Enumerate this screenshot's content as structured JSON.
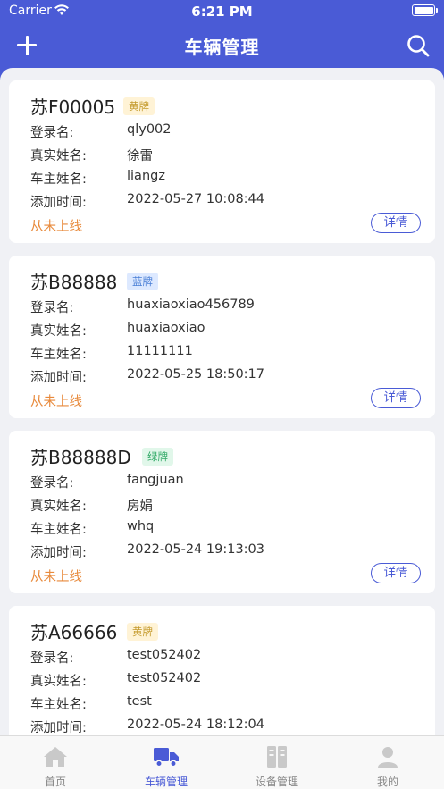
{
  "status_bar": {
    "carrier": "Carrier",
    "time": "6:21 PM"
  },
  "nav": {
    "title": "车辆管理"
  },
  "labels": {
    "login": "登录名:",
    "real_name": "真实姓名:",
    "owner": "车主姓名:",
    "added": "添加时间:",
    "detail": "详情"
  },
  "colors": {
    "primary": "#4a5bd6",
    "offline": "#e88a3c"
  },
  "vehicles": [
    {
      "plate": "苏F00005",
      "plate_type": "黄牌",
      "login": "qly002",
      "real_name": "徐雷",
      "owner": "liangz",
      "added": "2022-05-27 10:08:44",
      "status": "从未上线"
    },
    {
      "plate": "苏B88888",
      "plate_type": "蓝牌",
      "login": "huaxiaoxiao456789",
      "real_name": "huaxiaoxiao",
      "owner": "11111111",
      "added": "2022-05-25 18:50:17",
      "status": "从未上线"
    },
    {
      "plate": "苏B88888D",
      "plate_type": "绿牌",
      "login": "fangjuan",
      "real_name": "房娟",
      "owner": "whq",
      "added": "2022-05-24 19:13:03",
      "status": "从未上线"
    },
    {
      "plate": "苏A66666",
      "plate_type": "黄牌",
      "login": "test052402",
      "real_name": "test052402",
      "owner": "test",
      "added": "2022-05-24 18:12:04"
    }
  ],
  "tabs": [
    {
      "label": "首页",
      "icon": "home-icon"
    },
    {
      "label": "车辆管理",
      "icon": "truck-icon",
      "active": true
    },
    {
      "label": "设备管理",
      "icon": "device-icon"
    },
    {
      "label": "我的",
      "icon": "user-icon"
    }
  ]
}
